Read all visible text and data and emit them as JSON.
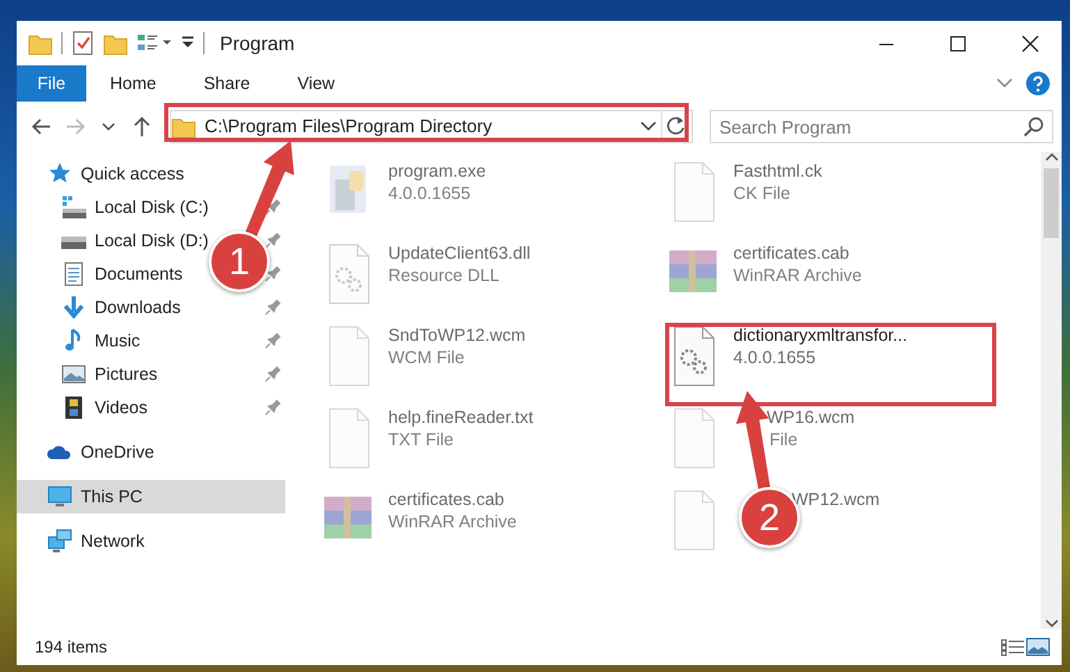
{
  "window": {
    "title": "Program"
  },
  "ribbon_tabs": [
    {
      "label": "File",
      "kind": "file"
    },
    {
      "label": "Home",
      "kind": "tab"
    },
    {
      "label": "Share",
      "kind": "tab"
    },
    {
      "label": "View",
      "kind": "tab"
    }
  ],
  "address_bar": {
    "path": "C:\\Program Files\\Program Directory",
    "annotated": true
  },
  "search": {
    "placeholder": "Search Program"
  },
  "sidebar": {
    "items": [
      {
        "label": "Quick access",
        "kind": "star",
        "selected": false,
        "children": [
          {
            "label": "Local Disk (C:)",
            "kind": "system-drive",
            "pinned": true,
            "selected": false
          },
          {
            "label": "Local Disk (D:)",
            "kind": "drive",
            "pinned": true,
            "selected": false
          },
          {
            "label": "Documents",
            "kind": "document",
            "pinned": true,
            "selected": false
          },
          {
            "label": "Downloads",
            "kind": "download",
            "pinned": true,
            "selected": false
          },
          {
            "label": "Music",
            "kind": "music",
            "pinned": true,
            "selected": false
          },
          {
            "label": "Pictures",
            "kind": "picture",
            "pinned": true,
            "selected": false
          },
          {
            "label": "Videos",
            "kind": "video",
            "pinned": true,
            "selected": false
          }
        ]
      },
      {
        "label": "OneDrive",
        "kind": "cloud",
        "selected": false
      },
      {
        "label": "This PC",
        "kind": "monitor",
        "selected": true
      },
      {
        "label": "Network",
        "kind": "network",
        "selected": false
      }
    ]
  },
  "files": [
    {
      "name": "program.exe",
      "detail": "4.0.0.1655",
      "kind": "exe",
      "dimmed": true,
      "annotated": false
    },
    {
      "name": "Fasthtml.ck",
      "detail": "CK File",
      "kind": "file",
      "dimmed": true,
      "annotated": false
    },
    {
      "name": "UpdateClient63.dll",
      "detail": "Resource DLL",
      "kind": "dll",
      "dimmed": true,
      "annotated": false
    },
    {
      "name": "certificates.cab",
      "detail": "WinRAR Archive",
      "kind": "archive",
      "dimmed": true,
      "annotated": false
    },
    {
      "name": "SndToWP12.wcm",
      "detail": "WCM File",
      "kind": "file",
      "dimmed": true,
      "annotated": false
    },
    {
      "name": "dictionaryxmltransfor...",
      "detail": "4.0.0.1655",
      "kind": "dll",
      "dimmed": false,
      "annotated": true
    },
    {
      "name": "help.fineReader.txt",
      "detail": "TXT File",
      "kind": "file",
      "dimmed": true,
      "annotated": false
    },
    {
      "name": "WP16.wcm",
      "detail": "File",
      "kind": "file",
      "dimmed": true,
      "annotated": false
    },
    {
      "name": "certificates.cab",
      "detail": "WinRAR Archive",
      "kind": "archive",
      "dimmed": true,
      "annotated": false
    },
    {
      "name": "WP12.wcm",
      "kind": "file",
      "dimmed": true,
      "annotated": false
    }
  ],
  "status_bar": {
    "count": "194 items"
  },
  "annotations": [
    {
      "label": "1"
    },
    {
      "label": "2"
    }
  ]
}
